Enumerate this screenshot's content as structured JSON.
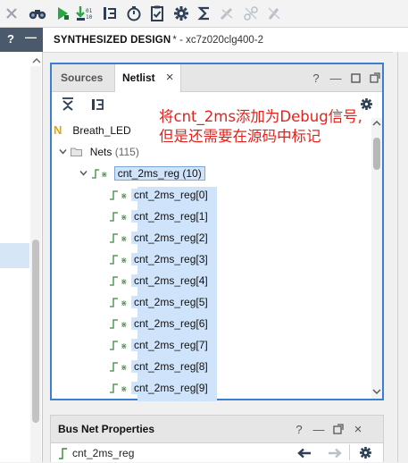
{
  "toolbar": {
    "icons": [
      "close-icon",
      "binoculars-icon",
      "run-icon",
      "download-bitstream-icon",
      "step-icon",
      "stopwatch-icon",
      "checklist-icon",
      "gear-icon",
      "sigma-icon",
      "disabled-probe-icon",
      "disabled-net-icon",
      "disabled-tool-icon"
    ]
  },
  "left_header": {
    "help": "?",
    "minimize": "—"
  },
  "title_bar": {
    "title": "SYNTHESIZED DESIGN",
    "subtitle": "* - xc7z020clg400-2"
  },
  "netlist_panel": {
    "tabs": [
      {
        "label": "Sources"
      },
      {
        "label": "Netlist",
        "close": "×"
      }
    ],
    "controls": {
      "help": "?",
      "minimize": "—"
    },
    "tree": {
      "root": "Breath_LED",
      "nets_label": "Nets",
      "nets_count": "(115)",
      "parent_net": "cnt_2ms_reg (10)",
      "children": [
        "cnt_2ms_reg[0]",
        "cnt_2ms_reg[1]",
        "cnt_2ms_reg[2]",
        "cnt_2ms_reg[3]",
        "cnt_2ms_reg[4]",
        "cnt_2ms_reg[5]",
        "cnt_2ms_reg[6]",
        "cnt_2ms_reg[7]",
        "cnt_2ms_reg[8]",
        "cnt_2ms_reg[9]"
      ]
    },
    "annotation_line1": "将cnt_2ms添加为Debug信号,",
    "annotation_line2": "但是还需要在源码中标记"
  },
  "props_panel": {
    "title": "Bus Net Properties",
    "controls": {
      "help": "?",
      "minimize": "—"
    },
    "net_name": "cnt_2ms_reg"
  },
  "colors": {
    "accent_blue": "#3b7fd1",
    "selection": "#cfe3fa",
    "annotation_red": "#e0241d",
    "header_dark": "#4a5a6c"
  }
}
